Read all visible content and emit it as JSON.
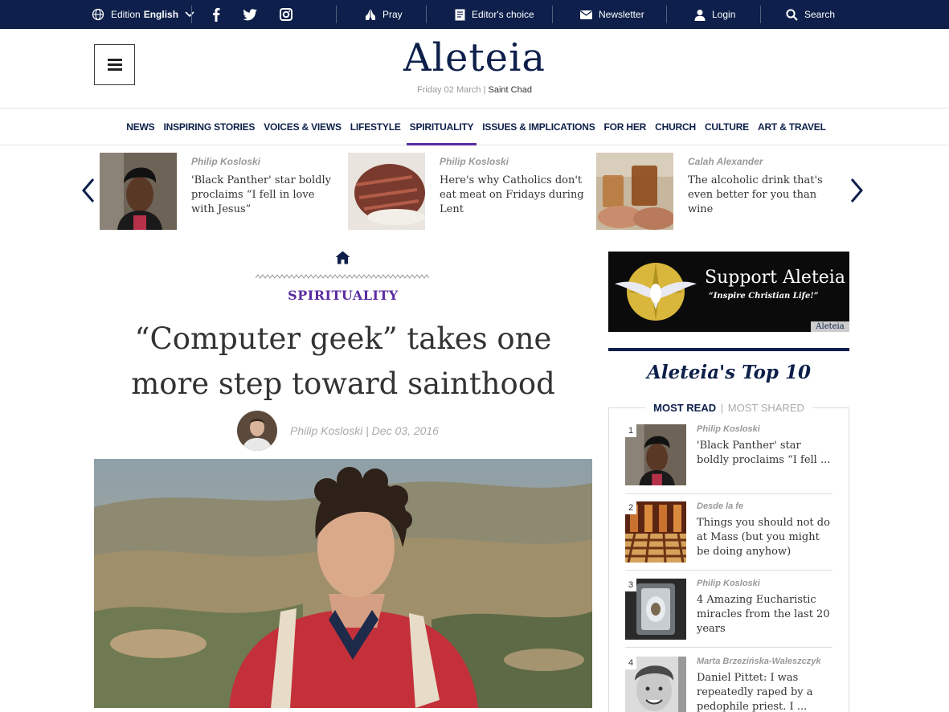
{
  "topbar": {
    "edition_label": "Edition",
    "edition_value": "English",
    "pray": "Pray",
    "editors_choice": "Editor's choice",
    "newsletter": "Newsletter",
    "login": "Login",
    "search": "Search"
  },
  "header": {
    "logo": "Aleteia",
    "date": "Friday 02 March",
    "saint": "Saint Chad"
  },
  "nav": [
    "NEWS",
    "INSPIRING STORIES",
    "VOICES & VIEWS",
    "LIFESTYLE",
    "SPIRITUALITY",
    "ISSUES & IMPLICATIONS",
    "FOR HER",
    "CHURCH",
    "CULTURE",
    "ART & TRAVEL"
  ],
  "nav_active": "SPIRITUALITY",
  "carousel": [
    {
      "author": "Philip Kosloski",
      "title": "'Black Panther' star boldly proclaims “I fell in love with Jesus”"
    },
    {
      "author": "Philip Kosloski",
      "title": "Here's why Catholics don't eat meat on Fridays during Lent"
    },
    {
      "author": "Calah Alexander",
      "title": "The alcoholic drink that's even better for you than wine"
    }
  ],
  "article": {
    "section": "SPIRITUALITY",
    "headline": "“Computer geek” takes one more step toward sainthood",
    "byline": "Philip Kosloski | Dec 03, 2016"
  },
  "ad": {
    "title": "Support Aleteia",
    "subtitle": "“Inspire Christian Life!”",
    "brand": "Aleteia"
  },
  "top10": {
    "title": "Aleteia's Top 10",
    "tab_active": "MOST READ",
    "tab_sep": "|",
    "tab_inactive": "MOST SHARED",
    "items": [
      {
        "num": "1",
        "author": "Philip Kosloski",
        "title": "'Black Panther' star boldly proclaims “I fell ..."
      },
      {
        "num": "2",
        "author": "Desde la fe",
        "title": "Things you should not do at Mass (but you might be doing anyhow)"
      },
      {
        "num": "3",
        "author": "Philip Kosloski",
        "title": "4 Amazing Eucharistic miracles from the last 20 years"
      },
      {
        "num": "4",
        "author": "Marta Brzezińska-Waleszczyk",
        "title": "Daniel Pittet: I was repeatedly raped by a pedophile priest. I ..."
      }
    ]
  },
  "colors": {
    "navy": "#0d1f4a",
    "purple": "#5a2ca0"
  }
}
